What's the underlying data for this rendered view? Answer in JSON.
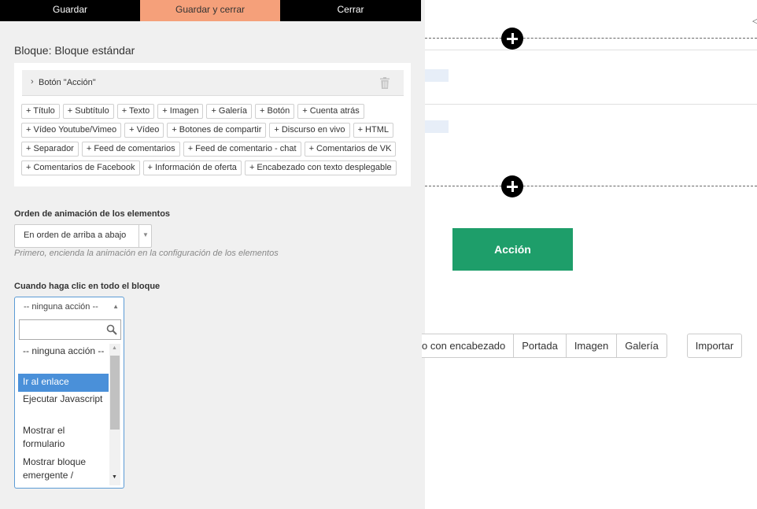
{
  "toolbar": {
    "save": "Guardar",
    "save_close": "Guardar y cerrar",
    "close": "Cerrar",
    "accent_color": "#f5a07a"
  },
  "block": {
    "title": "Bloque: Bloque estándar",
    "element": {
      "chevron": "›",
      "label": "Botón \"Acción\"",
      "delete_icon": "trash-icon"
    },
    "add_buttons": [
      "+ Título",
      "+ Subtítulo",
      "+ Texto",
      "+ Imagen",
      "+ Galería",
      "+ Botón",
      "+ Cuenta atrás",
      "+ Vídeo Youtube/Vimeo",
      "+ Vídeo",
      "+ Botones de compartir",
      "+ Discurso en vivo",
      "+ HTML",
      "+ Separador",
      "+ Feed de comentarios",
      "+ Feed de comentario - chat",
      "+ Comentarios de VK",
      "+ Comentarios de Facebook",
      "+ Información de oferta",
      "+ Encabezado con texto desplegable"
    ]
  },
  "animation": {
    "label": "Orden de animación de los elementos",
    "value": "En orden de arriba a abajo",
    "arrow": "▼",
    "hint": "Primero, encienda la animación en la configuración de los elementos"
  },
  "click_action": {
    "label": "Cuando haga clic en todo el bloque",
    "value": "-- ninguna acción --",
    "arrow": "▲",
    "search_placeholder": "",
    "options": [
      "-- ninguna acción --",
      "Ir al enlace",
      "Ejecutar Javascript",
      "Mostrar el formulario",
      "Mostrar bloque emergente /"
    ],
    "highlighted_index": 1,
    "highlight_color": "#4a90d9",
    "scroll_up": "▲",
    "scroll_down": "▼"
  },
  "canvas": {
    "corner_glyph": "◁",
    "action_button": "Acción",
    "action_color": "#1e9e6a",
    "template_tabs": [
      "o con encabezado",
      "Portada",
      "Imagen",
      "Galería"
    ],
    "import": "Importar"
  }
}
